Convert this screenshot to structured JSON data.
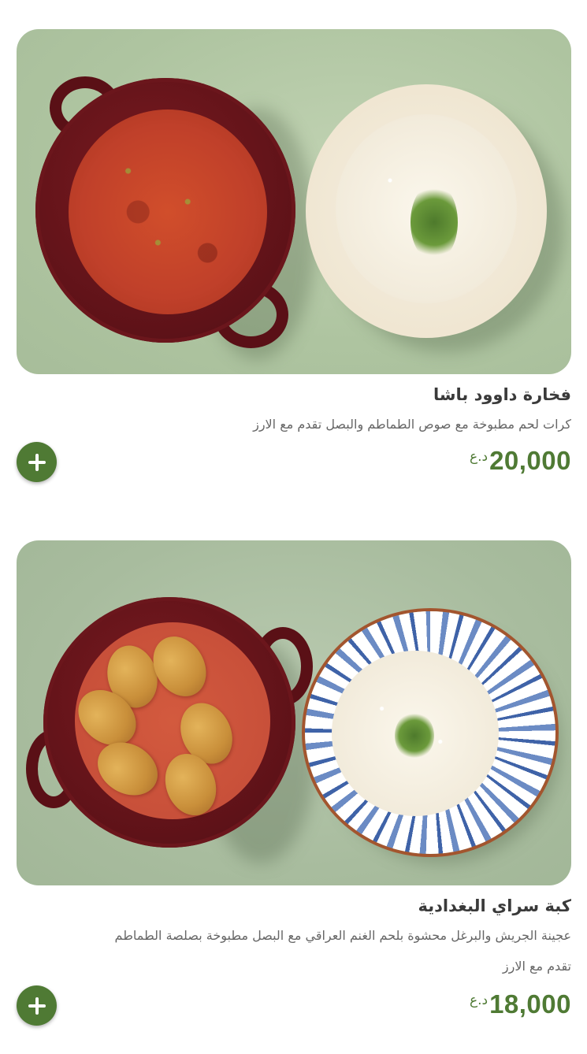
{
  "items": [
    {
      "title": "فخارة داوود باشا",
      "description_lines": [
        "كرات لحم مطبوخة مع صوص الطماطم والبصل تقدم مع الارز"
      ],
      "currency": "د.ع",
      "price": "20,000",
      "add_icon": "plus-icon"
    },
    {
      "title": "كبة سراي البغدادية",
      "description_lines": [
        "عجينة الجريش والبرغل محشوة بلحم الغنم العراقي مع البصل مطبوخة بصلصة الطماطم",
        "تقدم مع الارز"
      ],
      "currency": "د.ع",
      "price": "18,000",
      "add_icon": "plus-icon"
    }
  ],
  "colors": {
    "accent": "#4f7a34",
    "title": "#3a3a3a",
    "description": "#666666",
    "background": "#ffffff"
  }
}
